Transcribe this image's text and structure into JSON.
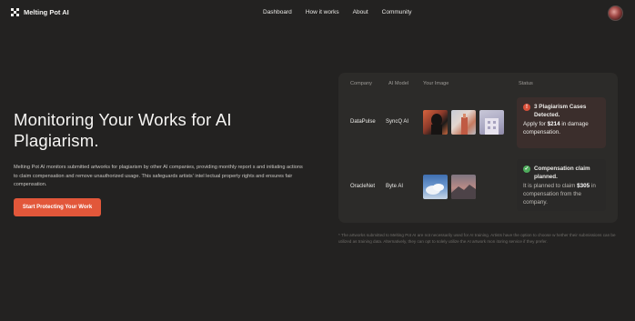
{
  "nav": {
    "brand": "Melting Pot AI",
    "links": [
      "Dashboard",
      "How it works",
      "About",
      "Community"
    ]
  },
  "hero": {
    "title": "Monitoring Your Works for AI Plagiarism.",
    "description": "Melting Pot AI monitors submitted artworks for plagiarism by other AI companies, providing monthly report s and initiating actions to claim compensation and remove unauthorized usage. This safeguards artists' intel lectual property rights and ensures fair compensation.",
    "cta": "Start Protecting Your Work"
  },
  "table": {
    "headers": [
      "Company",
      "AI Model",
      "Your Image",
      "Status"
    ],
    "rows": [
      {
        "company": "DataPulse",
        "model": "SyncQ AI",
        "status_title": "3 Plagiarism Cases Detected.",
        "status_prefix": "Apply for ",
        "status_amount": "$214",
        "status_suffix": " in damage compensation."
      },
      {
        "company": "OracleNet",
        "model": "Byte AI",
        "status_title": "Compensation claim planned.",
        "status_prefix": "It is planned to claim ",
        "status_amount": "$305",
        "status_suffix": " in compensation from the company."
      }
    ]
  },
  "footnote": "* The artworks submitted to Melting Pot AI are not necessarily used for AI training. Artists have the option to choose w hether their submissions can be utilized as training data. Alternatively, they can opt to solely utilize the AI artwork mon itoring service if they prefer.",
  "colors": {
    "background": "#232221",
    "accent": "#e2573a",
    "alert": "#d9503a",
    "success": "#4eab5c"
  },
  "icons": {
    "alert": "exclamation-circle-icon",
    "ok": "check-circle-icon"
  }
}
